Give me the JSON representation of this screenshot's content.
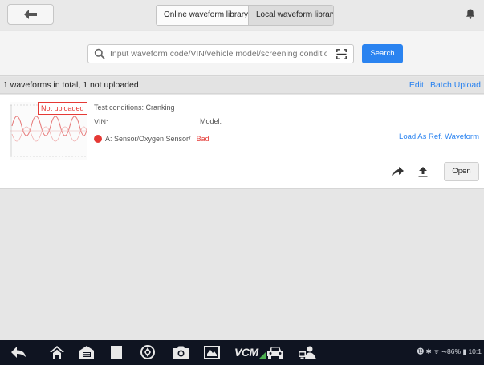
{
  "header": {
    "tabs": [
      {
        "label": "Online waveform library",
        "active": false
      },
      {
        "label": "Local waveform library",
        "active": true
      }
    ],
    "back_icon": "arrow-left-icon",
    "notification_icon": "bell-icon"
  },
  "search": {
    "placeholder": "Input waveform code/VIN/vehicle model/screening conditions",
    "value": "",
    "button_label": "Search",
    "scan_icon": "scan-icon"
  },
  "summary": {
    "text": "1 waveforms in total, 1 not uploaded",
    "edit_label": "Edit",
    "batch_upload_label": "Batch Upload"
  },
  "waveforms": [
    {
      "status_badge": "Not uploaded",
      "test_conditions": "Test conditions: Cranking",
      "vin": "VIN:",
      "model": "Model:",
      "channel": "A: Sensor/Oxygen Sensor/",
      "result": "Bad",
      "ref_link": "Load As Ref. Waveform",
      "open_label": "Open"
    }
  ],
  "colors": {
    "accent": "#2a83f0",
    "error": "#e53935",
    "navbar": "#0f1421"
  },
  "navbar": {
    "icons": [
      "back-icon",
      "home-icon",
      "garage-icon",
      "recent-apps-icon",
      "browser-icon",
      "camera-icon",
      "screenshot-icon",
      "vcm-icon",
      "car-icon",
      "remote-support-icon"
    ],
    "vcm_label": "VCM",
    "status_text": "⓬ ✱ ᯤ  ⏦86% ▮ 10:1"
  }
}
